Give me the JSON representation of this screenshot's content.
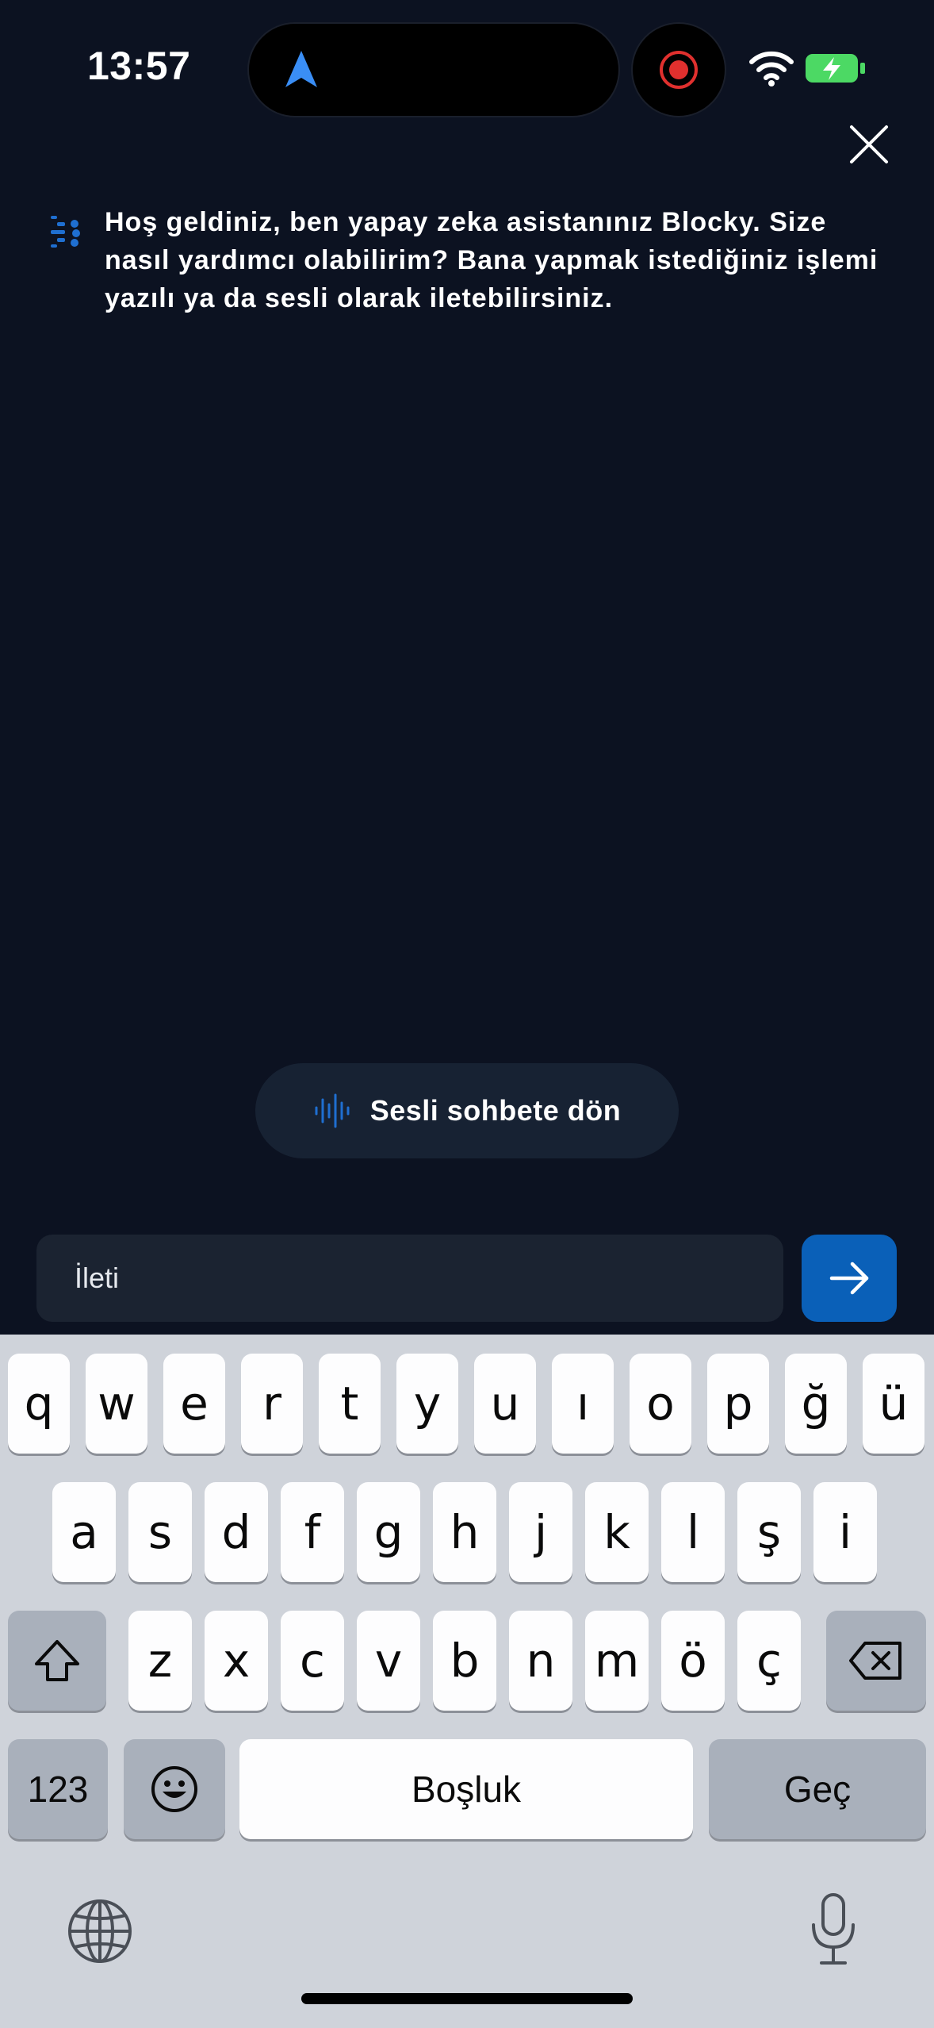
{
  "status_bar": {
    "time": "13:57"
  },
  "colors": {
    "background": "#0c1221",
    "accent": "#0a60b8",
    "pill": "#172233",
    "input": "#1b2331",
    "keyboard": "#cfd3da",
    "recording": "#e0302e",
    "battery": "#4cd964"
  },
  "icons": {
    "close": "close-icon",
    "send": "arrow-right-icon",
    "voice": "waveform-icon",
    "avatar": "blocky-logo-icon",
    "navigation": "navigation-arrow-icon",
    "recording": "record-icon"
  },
  "chat": {
    "assistant_message": "Hoş geldiniz, ben yapay zeka asistanınız Blocky. Size nasıl yardımcı olabilirim? Bana yapmak istediğiniz işlemi yazılı ya da sesli olarak iletebilirsiniz."
  },
  "voice_chat": {
    "label": "Sesli sohbete dön"
  },
  "composer": {
    "placeholder": "İleti"
  },
  "keyboard": {
    "row1": [
      "q",
      "w",
      "e",
      "r",
      "t",
      "y",
      "u",
      "ı",
      "o",
      "p",
      "ğ",
      "ü"
    ],
    "row2": [
      "a",
      "s",
      "d",
      "f",
      "g",
      "h",
      "j",
      "k",
      "l",
      "ş",
      "i"
    ],
    "row3": [
      "z",
      "x",
      "c",
      "v",
      "b",
      "n",
      "m",
      "ö",
      "ç"
    ],
    "numbers_label": "123",
    "space_label": "Boşluk",
    "return_label": "Geç"
  }
}
